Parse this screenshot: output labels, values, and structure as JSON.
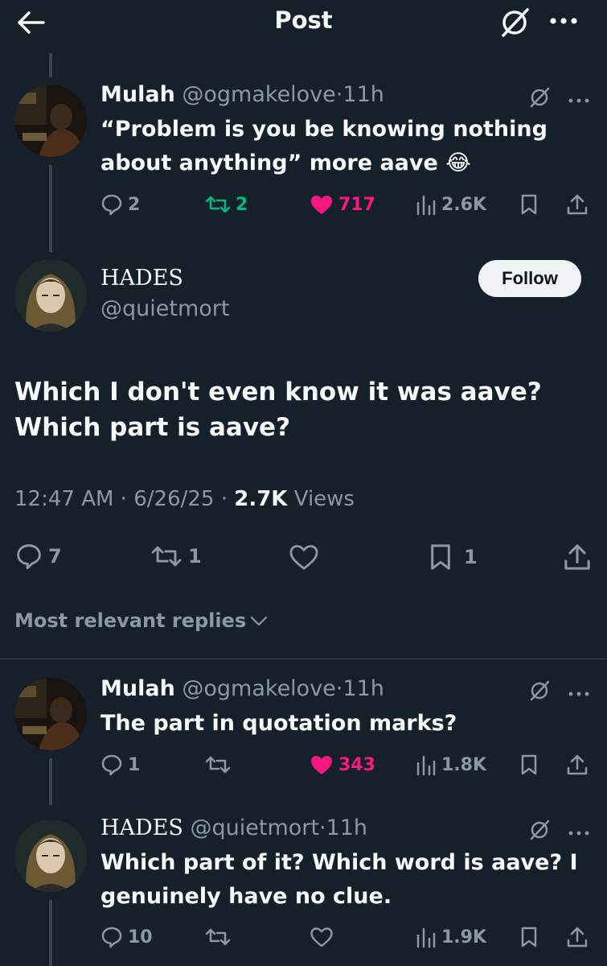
{
  "header": {
    "title": "Post"
  },
  "parent_tweet": {
    "name": "Mulah",
    "handle": "@ogmakelove",
    "time": "11h",
    "text_line1": "“Problem is you be knowing nothing",
    "text_line2": "about anything” more aave 😂",
    "replies": "2",
    "retweets": "2",
    "likes": "717",
    "views": "2.6K"
  },
  "main_tweet": {
    "name": "HADES",
    "handle": "@quietmort",
    "follow_label": "Follow",
    "text_line1": "Which I don't even know it was aave?",
    "text_line2": "Which part is aave?",
    "time": "12:47 AM",
    "date": "6/26/25",
    "views_count": "2.7K",
    "views_label": "Views",
    "replies": "7",
    "retweets": "1",
    "bookmarks": "1"
  },
  "replies_filter": {
    "label": "Most relevant replies"
  },
  "reply1": {
    "name": "Mulah",
    "handle": "@ogmakelove",
    "time": "11h",
    "text": "The part in quotation marks?",
    "replies": "1",
    "likes": "343",
    "views": "1.8K"
  },
  "reply2": {
    "name": "HADES",
    "handle": "@quietmort",
    "time": "11h",
    "text_line1": "Which part of it? Which word is aave? I",
    "text_line2": "genuinely have no clue.",
    "replies": "10",
    "views": "1.9K"
  },
  "colors": {
    "background": "#15202b",
    "muted": "#8b98a5",
    "like_pink": "#f91880",
    "retweet_green": "#00ba7c"
  }
}
